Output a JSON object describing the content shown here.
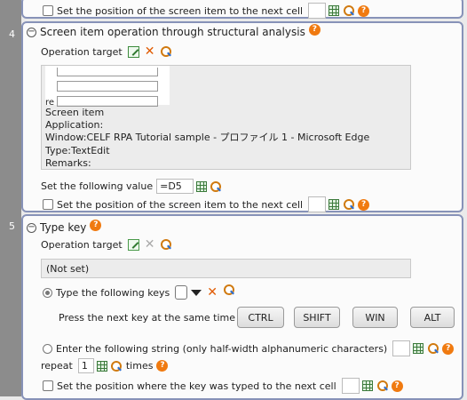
{
  "steps": {
    "prev": {
      "cell_label": "Set the position of the screen item to the next cell"
    },
    "step4": {
      "number": "4",
      "title": "Screen item operation through structural analysis",
      "operation_target_label": "Operation target",
      "preview_stub": "re",
      "info_lines": [
        "Screen item",
        "Application:",
        "Window:CELF RPA Tutorial sample - プロファイル 1 - Microsoft Edge",
        "Type:TextEdit",
        "Remarks:"
      ],
      "set_value_label": "Set the following value",
      "set_value": "=D5",
      "cell_label": "Set the position of the screen item to the next cell"
    },
    "step5": {
      "number": "5",
      "title": "Type key",
      "operation_target_label": "Operation target",
      "not_set": "(Not set)",
      "type_keys_label": "Type the following keys",
      "press_label": "Press the next key at the same time",
      "key_buttons": [
        "CTRL",
        "SHIFT",
        "WIN",
        "ALT"
      ],
      "string_label": "Enter the following string (only half-width alphanumeric characters)",
      "repeat_label": "repeat",
      "repeat_value": "1",
      "times_label": "times",
      "cell_label": "Set the position where the key was typed to the next cell"
    }
  },
  "icons": {
    "help": "?"
  },
  "colors": {
    "card_border": "#8792b8",
    "gutter": "#8c8c8c",
    "help": "#f07a10",
    "delete": "#e05a00"
  }
}
